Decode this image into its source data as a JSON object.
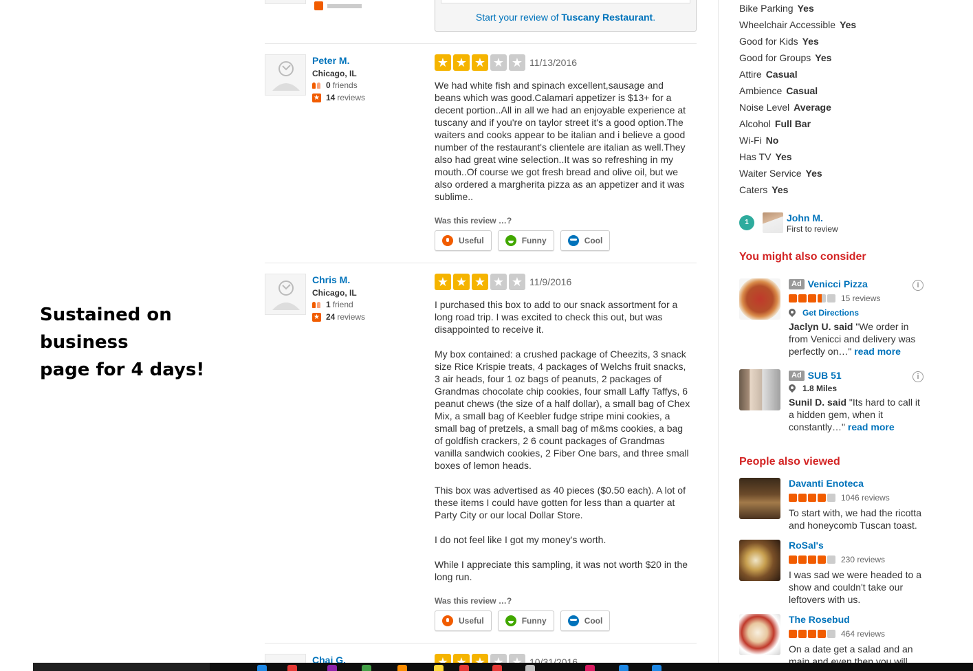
{
  "annotation": {
    "line1": "Sustained on business",
    "line2": "page for 4 days!"
  },
  "start_review": {
    "prefix": "Start your review of ",
    "business": "Tuscany Restaurant",
    "suffix": "."
  },
  "reviews": [
    {
      "name": "Peter M.",
      "location": "Chicago, IL",
      "friends_count": "0",
      "friends_label": "friends",
      "reviews_count": "14",
      "reviews_label": "reviews",
      "rating": 3,
      "date": "11/13/2016",
      "paragraphs": [
        "We had white fish and spinach excellent,sausage and beans which was good.Calamari appetizer is $13+ for a decent portion..All in all we had an enjoyable experience at tuscany and if you're on taylor street it's a good option.The waiters and cooks appear to be italian and i believe a good number of the restaurant's clientele are italian as well.They also had great wine selection..It was so refreshing in my mouth..Of course we got fresh bread and olive oil, but we also ordered a margherita pizza as an appetizer and it was sublime.."
      ],
      "helpful_prompt": "Was this review …?",
      "votes": {
        "useful": "Useful",
        "funny": "Funny",
        "cool": "Cool"
      }
    },
    {
      "name": "Chris M.",
      "location": "Chicago, IL",
      "friends_count": "1",
      "friends_label": "friend",
      "reviews_count": "24",
      "reviews_label": "reviews",
      "rating": 3,
      "date": "11/9/2016",
      "paragraphs": [
        "I purchased this box to add to our snack assortment for a long road trip. I was excited to check this out, but was disappointed to receive it.",
        "My box contained: a crushed package of Cheezits, 3 snack size Rice Krispie treats, 4 packages of Welchs fruit snacks, 3 air heads, four 1 oz bags of peanuts, 2 packages of Grandmas chocolate chip cookies, four small Laffy Taffys, 6 peanut chews (the size of a half dollar), a small bag of Chex Mix, a small bag of Keebler fudge stripe mini cookies, a small bag of pretzels, a small bag of m&ms cookies, a bag of goldfish crackers, 2 6 count packages of Grandmas vanilla sandwich cookies, 2 Fiber One bars, and three small boxes of lemon heads.",
        "This box was advertised as 40 pieces ($0.50 each). A lot of these items I could have gotten for less than a quarter at Party City or our local Dollar Store.",
        "I do not feel like I got my money's worth.",
        "While I appreciate this sampling, it was not worth $20 in the long run."
      ],
      "helpful_prompt": "Was this review …?",
      "votes": {
        "useful": "Useful",
        "funny": "Funny",
        "cool": "Cool"
      }
    },
    {
      "name": "Chai G.",
      "rating": 3,
      "date": "10/31/2016"
    }
  ],
  "attributes": [
    {
      "label": "Bike Parking",
      "value": "Yes"
    },
    {
      "label": "Wheelchair Accessible",
      "value": "Yes"
    },
    {
      "label": "Good for Kids",
      "value": "Yes"
    },
    {
      "label": "Good for Groups",
      "value": "Yes"
    },
    {
      "label": "Attire",
      "value": "Casual"
    },
    {
      "label": "Ambience",
      "value": "Casual"
    },
    {
      "label": "Noise Level",
      "value": "Average"
    },
    {
      "label": "Alcohol",
      "value": "Full Bar"
    },
    {
      "label": "Wi-Fi",
      "value": "No"
    },
    {
      "label": "Has TV",
      "value": "Yes"
    },
    {
      "label": "Waiter Service",
      "value": "Yes"
    },
    {
      "label": "Caters",
      "value": "Yes"
    }
  ],
  "first_to_review": {
    "badge": "1",
    "name": "John M.",
    "label": "First to review"
  },
  "also_consider": {
    "title": "You might also consider",
    "items": [
      {
        "ad": "Ad",
        "name": "Venicci Pizza",
        "rating": 3.5,
        "reviews": "15 reviews",
        "location_text": "Get Directions",
        "quote_author": "Jaclyn U. said",
        "quote": " \"We order in from Venicci and delivery was perfectly on…\" ",
        "more": "read more"
      },
      {
        "ad": "Ad",
        "name": "SUB 51",
        "location_text": "1.8 Miles",
        "quote_author": "Sunil D. said",
        "quote": " \"Its hard to call it a hidden gem, when it constantly…\" ",
        "more": "read more"
      }
    ]
  },
  "people_viewed": {
    "title": "People also viewed",
    "items": [
      {
        "name": "Davanti Enoteca",
        "rating": 4,
        "reviews": "1046 reviews",
        "text": "To start with, we had the ricotta and honeycomb Tuscan toast."
      },
      {
        "name": "RoSal's",
        "rating": 4,
        "reviews": "230 reviews",
        "text": "I was sad we were headed to a show and couldn't take our leftovers with us."
      },
      {
        "name": "The Rosebud",
        "rating": 4,
        "reviews": "464 reviews",
        "text": "On a date get a salad and an main and even then you will"
      }
    ]
  },
  "colors": {
    "link": "#0073bb",
    "section_title": "#d32323",
    "star_on": "#f5b400",
    "brand_orange": "#f15c00"
  }
}
